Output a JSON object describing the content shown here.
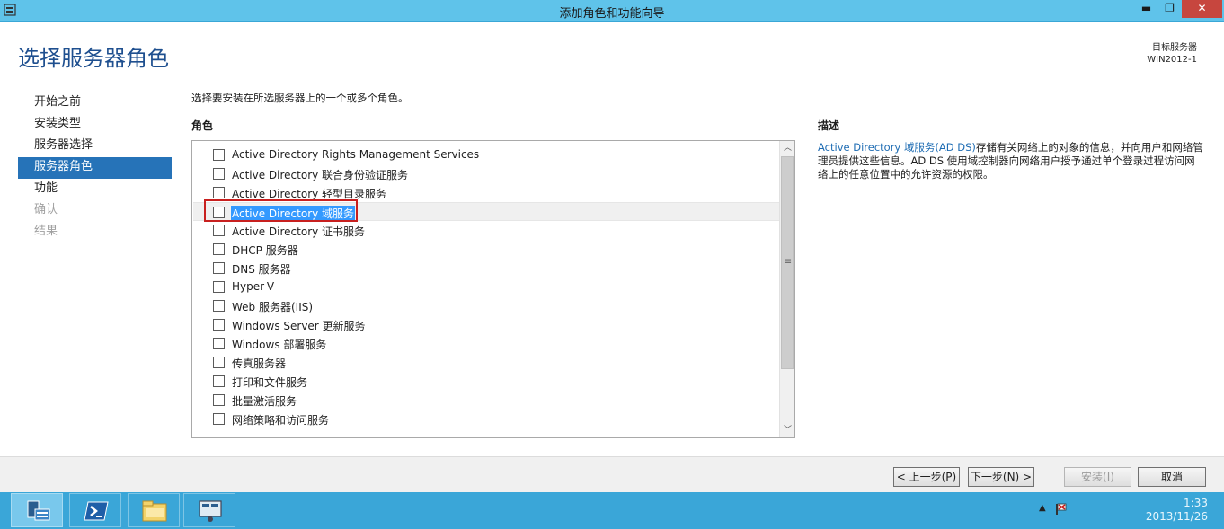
{
  "window": {
    "title": "添加角色和功能向导",
    "minimize_icon": "minimize-icon",
    "maximize_icon": "restore-icon",
    "close_icon": "close-icon",
    "minimize_glyph": "▬",
    "restore_glyph": "❐",
    "close_glyph": "✕"
  },
  "header": {
    "page_title": "选择服务器角色",
    "target_label": "目标服务器",
    "target_value": "WIN2012-1"
  },
  "nav": {
    "items": [
      {
        "label": "开始之前",
        "state": "normal"
      },
      {
        "label": "安装类型",
        "state": "normal"
      },
      {
        "label": "服务器选择",
        "state": "normal"
      },
      {
        "label": "服务器角色",
        "state": "active"
      },
      {
        "label": "功能",
        "state": "normal"
      },
      {
        "label": "确认",
        "state": "disabled"
      },
      {
        "label": "结果",
        "state": "disabled"
      }
    ]
  },
  "main": {
    "instruction": "选择要安装在所选服务器上的一个或多个角色。",
    "roles_label": "角色",
    "roles": [
      {
        "label": "Active Directory Rights Management Services",
        "checked": false
      },
      {
        "label": "Active Directory 联合身份验证服务",
        "checked": false
      },
      {
        "label": "Active Directory 轻型目录服务",
        "checked": false
      },
      {
        "label": "Active Directory 域服务",
        "checked": false,
        "selected": true
      },
      {
        "label": "Active Directory 证书服务",
        "checked": false
      },
      {
        "label": "DHCP 服务器",
        "checked": false
      },
      {
        "label": "DNS 服务器",
        "checked": false
      },
      {
        "label": "Hyper-V",
        "checked": false
      },
      {
        "label": "Web 服务器(IIS)",
        "checked": false
      },
      {
        "label": "Windows Server 更新服务",
        "checked": false
      },
      {
        "label": "Windows 部署服务",
        "checked": false
      },
      {
        "label": "传真服务器",
        "checked": false
      },
      {
        "label": "打印和文件服务",
        "checked": false
      },
      {
        "label": "批量激活服务",
        "checked": false
      },
      {
        "label": "网络策略和访问服务",
        "checked": false
      }
    ],
    "scroll_up_glyph": "︿",
    "scroll_down_glyph": "﹀",
    "scroll_grip_glyph": "≡"
  },
  "description": {
    "label": "描述",
    "link_text": "Active Directory 域服务(AD DS)",
    "body": "存储有关网络上的对象的信息，并向用户和网络管理员提供这些信息。AD DS 使用域控制器向网络用户授予通过单个登录过程访问网络上的任意位置中的允许资源的权限。"
  },
  "footer": {
    "prev": "< 上一步(P)",
    "next": "下一步(N) >",
    "install": "安装(I)",
    "cancel": "取消"
  },
  "taskbar": {
    "apps": [
      {
        "icon": "server-manager-icon",
        "active": true
      },
      {
        "icon": "powershell-icon",
        "active": false
      },
      {
        "icon": "file-explorer-icon",
        "active": false
      },
      {
        "icon": "server-console-icon",
        "active": false
      }
    ],
    "tray_up_glyph": "▲",
    "time": "1:33",
    "date": "2013/11/26"
  },
  "colors": {
    "titlebar": "#5fc3ea",
    "accent": "#2673b8",
    "highlight": "#3399ff",
    "red_box": "#c8201f",
    "taskbar": "#3aa6d8"
  }
}
